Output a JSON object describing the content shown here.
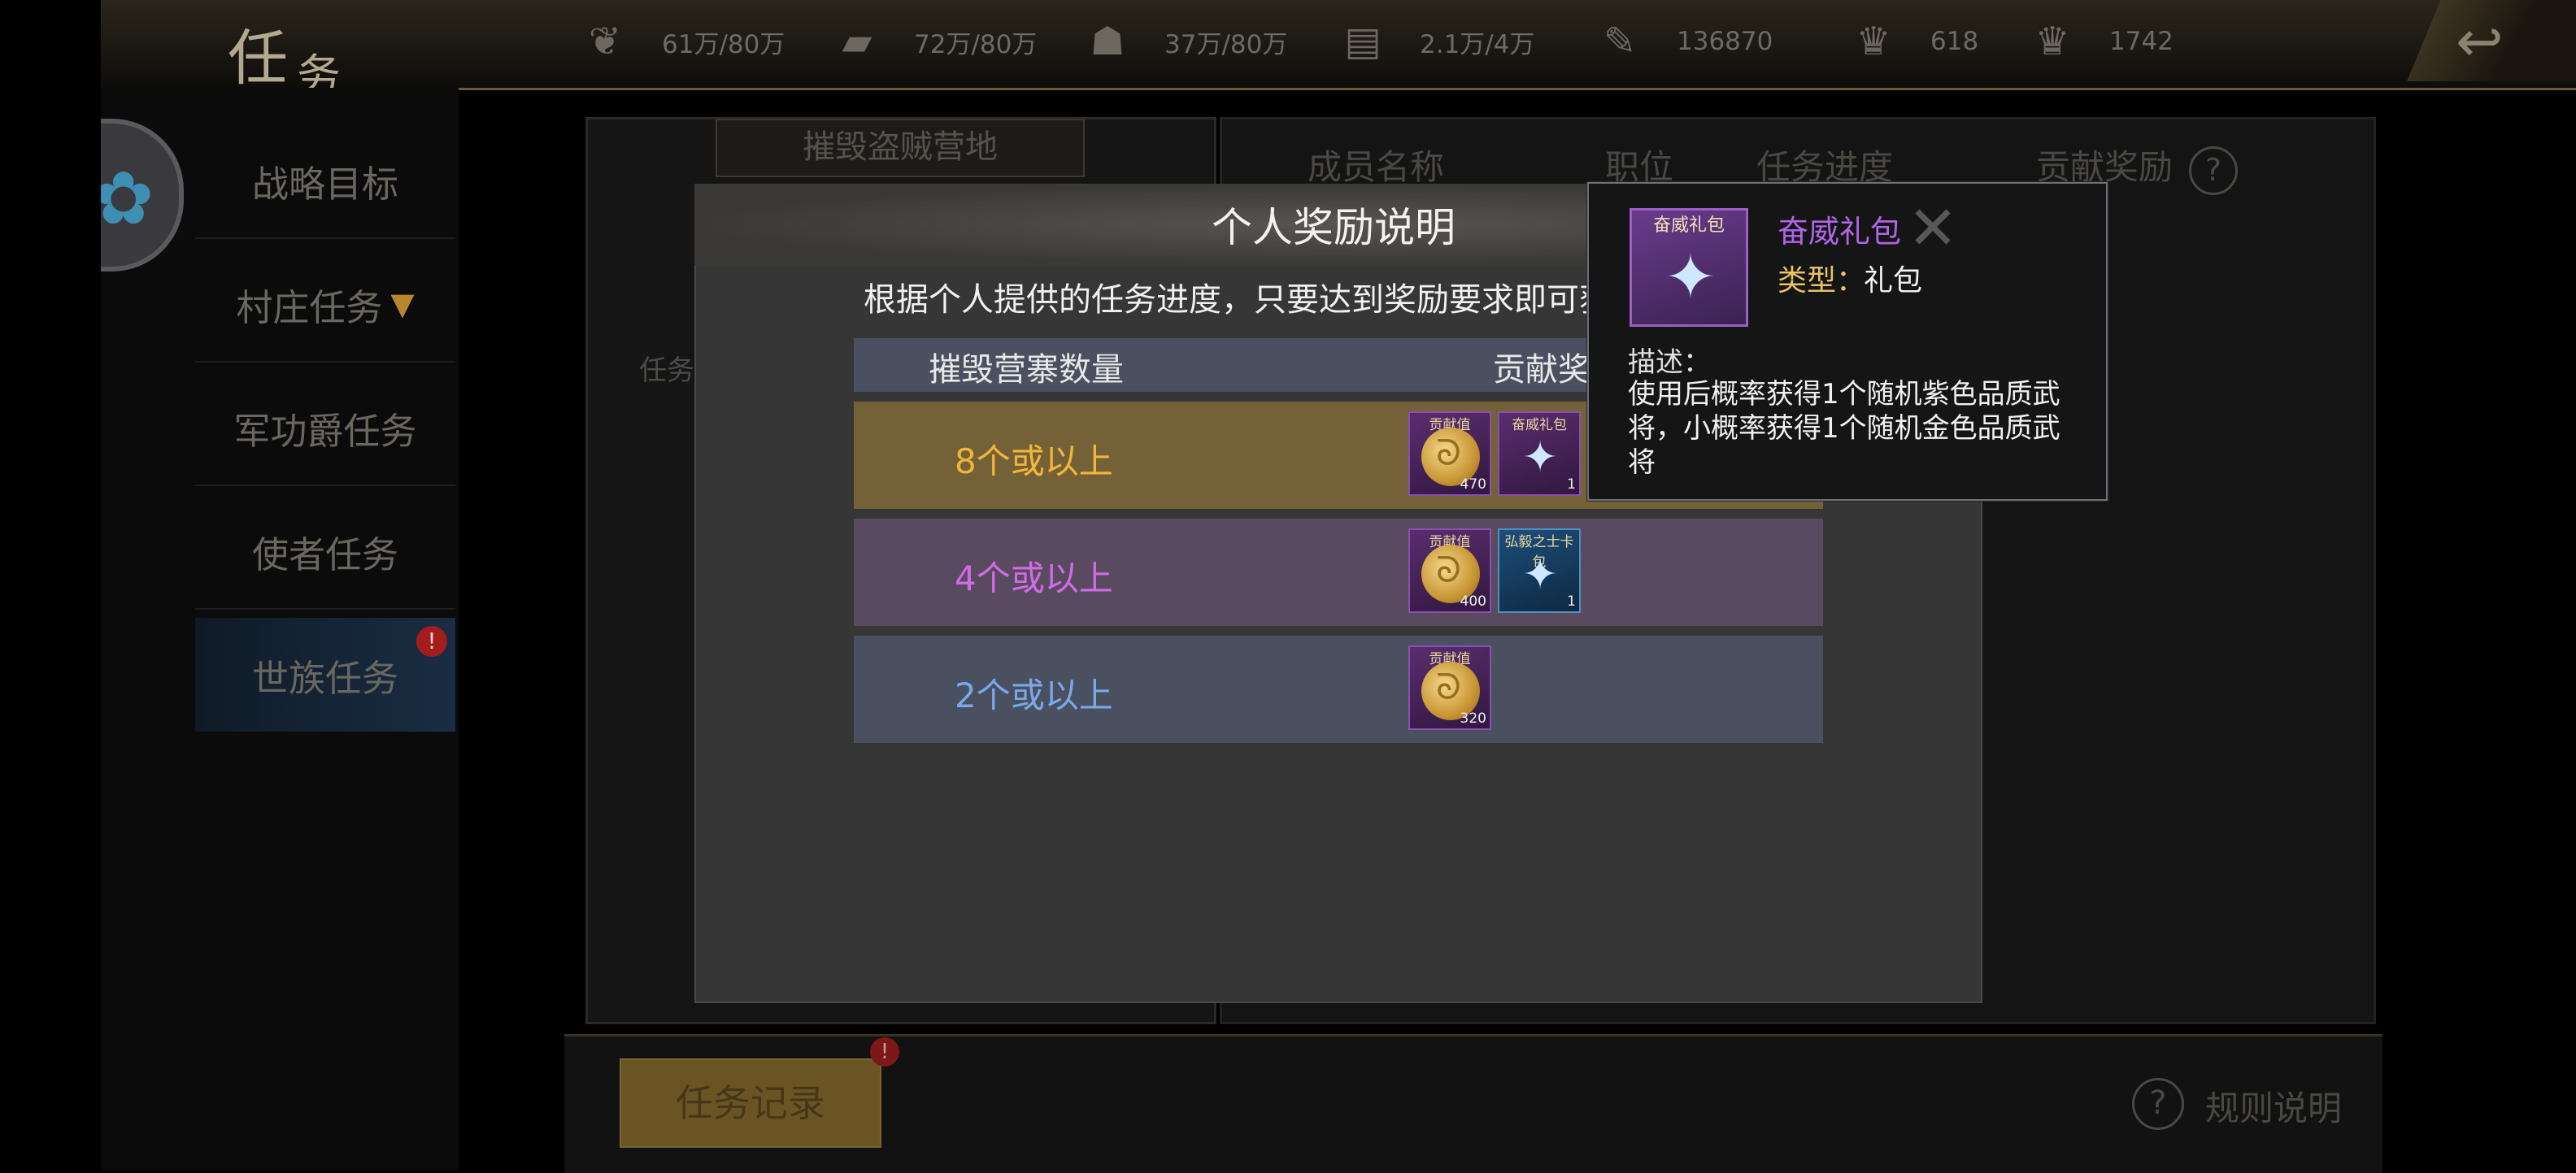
{
  "header": {
    "title_char1": "任",
    "title_char2": "务",
    "resources": [
      {
        "icon": "grain-icon",
        "glyph": "❦",
        "value": "61万/80万"
      },
      {
        "icon": "wood-icon",
        "glyph": "▰",
        "value": "72万/80万"
      },
      {
        "icon": "stone-icon",
        "glyph": "☗",
        "value": "37万/80万"
      },
      {
        "icon": "iron-icon",
        "glyph": "▤",
        "value": "2.1万/4万"
      },
      {
        "icon": "token-icon",
        "glyph": "✎",
        "value": "136870"
      },
      {
        "icon": "ingot-icon",
        "glyph": "♛",
        "value": "618"
      },
      {
        "icon": "gold-ingot-icon",
        "glyph": "♛",
        "value": "1742"
      }
    ],
    "back_glyph": "↩"
  },
  "nav": {
    "items": [
      {
        "label": "战略目标"
      },
      {
        "label": "村庄任务",
        "arrow": "▼"
      },
      {
        "label": "军功爵任务"
      },
      {
        "label": "使者任务"
      },
      {
        "label": "世族任务",
        "badge": "!"
      }
    ]
  },
  "left_panel": {
    "tab": "摧毁盗贼营地",
    "task_label": "任务"
  },
  "right_panel": {
    "columns": [
      "成员名称",
      "职位",
      "任务进度",
      "贡献奖励"
    ],
    "help": "?"
  },
  "bottom": {
    "task_record": "任务记录",
    "record_badge": "!",
    "rules_help": "?",
    "rules_label": "规则说明"
  },
  "modal": {
    "title": "个人奖励说明",
    "description": "根据个人提供的任务进度，只要达到奖励要求即可获得奖励。",
    "header_count": "摧毁营寨数量",
    "header_reward": "贡献奖励",
    "rows": [
      {
        "label": "8个或以上",
        "color": "#f0b63a",
        "items": [
          {
            "type": "coin",
            "top": "贡献值",
            "count": "470"
          },
          {
            "type": "pack",
            "top": "奋威礼包",
            "count": "1"
          }
        ]
      },
      {
        "label": "4个或以上",
        "color": "#d06be8",
        "items": [
          {
            "type": "coin",
            "top": "贡献值",
            "count": "400"
          },
          {
            "type": "pack-blue",
            "top": "弘毅之士卡包",
            "count": "1"
          }
        ]
      },
      {
        "label": "2个或以上",
        "color": "#7aa8e8",
        "items": [
          {
            "type": "coin",
            "top": "贡献值",
            "count": "320"
          }
        ]
      }
    ]
  },
  "tooltip": {
    "icon_top": "奋威礼包",
    "name": "奋威礼包",
    "close": "✕",
    "type_label": "类型：",
    "type_value": "礼包",
    "desc_label": "描述：",
    "description": "使用后概率获得1个随机紫色品质武将，小概率获得1个随机金色品质武将",
    "name_color": "#b064e8"
  }
}
